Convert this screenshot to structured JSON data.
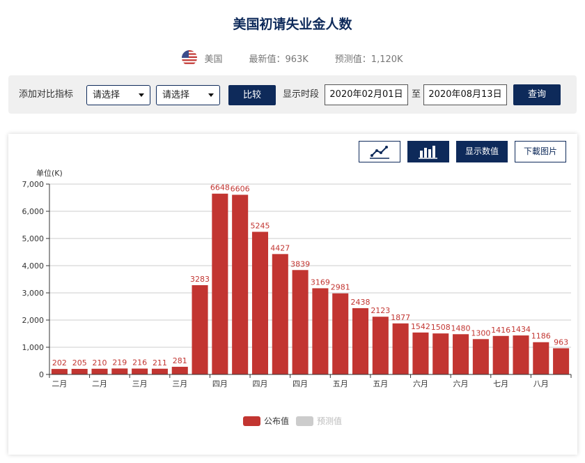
{
  "page": {
    "title": "美国初请失业金人数",
    "country": "美国",
    "latest_text": "最新值：963K",
    "forecast_text": "预测值：1,120K"
  },
  "controls": {
    "add_compare_label": "添加对比指标",
    "select1_value": "请选择",
    "select2_value": "请选择",
    "compare_button": "比较",
    "period_label": "显示时段",
    "start_date": "2020年02月01日",
    "to_label": "至",
    "end_date": "2020年08月13日",
    "query_button": "查询"
  },
  "toolbar": {
    "line_icon": "line-chart-icon",
    "bar_icon": "bar-chart-icon",
    "show_values_label": "显示数值",
    "download_label": "下載图片"
  },
  "colors": {
    "navy": "#0e2a5a",
    "bar": "#c23531",
    "forecast": "#cccccc"
  },
  "chart_data": {
    "type": "bar",
    "ylabel": "单位(K)",
    "ylim": [
      0,
      7000
    ],
    "yticks": [
      "0",
      "1,000",
      "2,000",
      "3,000",
      "4,000",
      "5,000",
      "6,000",
      "7,000"
    ],
    "x_tick_labels": [
      "二月",
      "二月",
      "三月",
      "三月",
      "四月",
      "四月",
      "四月",
      "五月",
      "五月",
      "六月",
      "六月",
      "七月",
      "八月"
    ],
    "values": [
      202,
      205,
      210,
      219,
      216,
      211,
      281,
      3283,
      6648,
      6606,
      5245,
      4427,
      3839,
      3169,
      2981,
      2438,
      2123,
      1877,
      1542,
      1508,
      1480,
      1300,
      1416,
      1434,
      1186,
      963
    ],
    "grid": true,
    "legend_position": "bottom",
    "series": [
      {
        "name": "公布值",
        "color": "#c23531"
      },
      {
        "name": "预测值",
        "color": "#cccccc"
      }
    ]
  }
}
